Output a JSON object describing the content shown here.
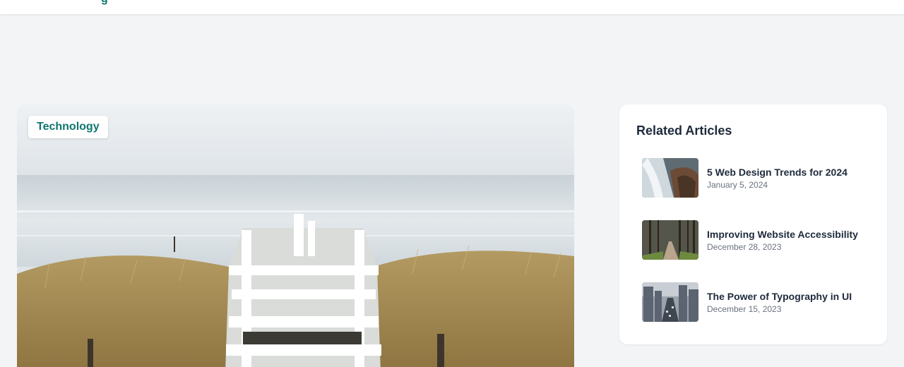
{
  "header": {
    "logo_fragment": "g"
  },
  "hero": {
    "category_tag": "Technology",
    "image_icon": "beach-boardwalk-image"
  },
  "related": {
    "title": "Related Articles",
    "articles": [
      {
        "title": "5 Web Design Trends for 2024",
        "date": "January 5, 2024",
        "thumb_icon": "waterfall-image"
      },
      {
        "title": "Improving Website Accessibility",
        "date": "December 28, 2023",
        "thumb_icon": "forest-road-image"
      },
      {
        "title": "The Power of Typography in UI",
        "date": "December 15, 2023",
        "thumb_icon": "city-street-image"
      }
    ]
  },
  "colors": {
    "accent": "#0f766e",
    "heading": "#1e2a3b",
    "muted": "#6b7280",
    "page_bg": "#f2f4f6"
  }
}
